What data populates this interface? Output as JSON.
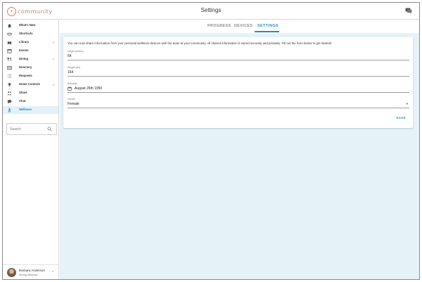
{
  "app": {
    "logo_text": "community",
    "page_title": "Settings"
  },
  "sidebar": {
    "items": [
      {
        "label": "What's New",
        "icon": "home-icon"
      },
      {
        "label": "Shortcuts",
        "icon": "shortcuts-icon"
      },
      {
        "label": "Library",
        "icon": "library-icon",
        "expandable": true
      },
      {
        "label": "Events",
        "icon": "calendar-icon"
      },
      {
        "label": "Dining",
        "icon": "dining-icon",
        "expandable": true
      },
      {
        "label": "Directory",
        "icon": "directory-icon"
      },
      {
        "label": "Requests",
        "icon": "requests-icon"
      },
      {
        "label": "Home Controls",
        "icon": "lightbulb-icon",
        "expandable": true
      },
      {
        "label": "Share",
        "icon": "share-icon"
      },
      {
        "label": "Chat",
        "icon": "chat-icon"
      },
      {
        "label": "Wellness",
        "icon": "wellness-icon",
        "active": true
      }
    ],
    "search_placeholder": "Search",
    "user": {
      "name": "Barbara Anderson",
      "location": "Spring Meadow"
    }
  },
  "tabs": [
    {
      "label": "PROGRESS",
      "active": false
    },
    {
      "label": "DEVICES",
      "active": false
    },
    {
      "label": "SETTINGS",
      "active": true
    }
  ],
  "form": {
    "intro": "You can now share information from your personal wellness devices with the team at your community. All shared information is stored securely and privately. Fill out the form below to get started!",
    "height": {
      "label": "Height (inches)",
      "value": "64"
    },
    "weight": {
      "label": "Weight (lbs)",
      "value": "164"
    },
    "birthdate": {
      "label": "Birthdate",
      "value": "August 26th 1950"
    },
    "gender": {
      "label": "Gender",
      "value": "Female"
    },
    "save_label": "SAVE"
  },
  "colors": {
    "accent": "#2a86b8",
    "main_bg": "#e5f3f8",
    "logo": "#e07a5f"
  }
}
